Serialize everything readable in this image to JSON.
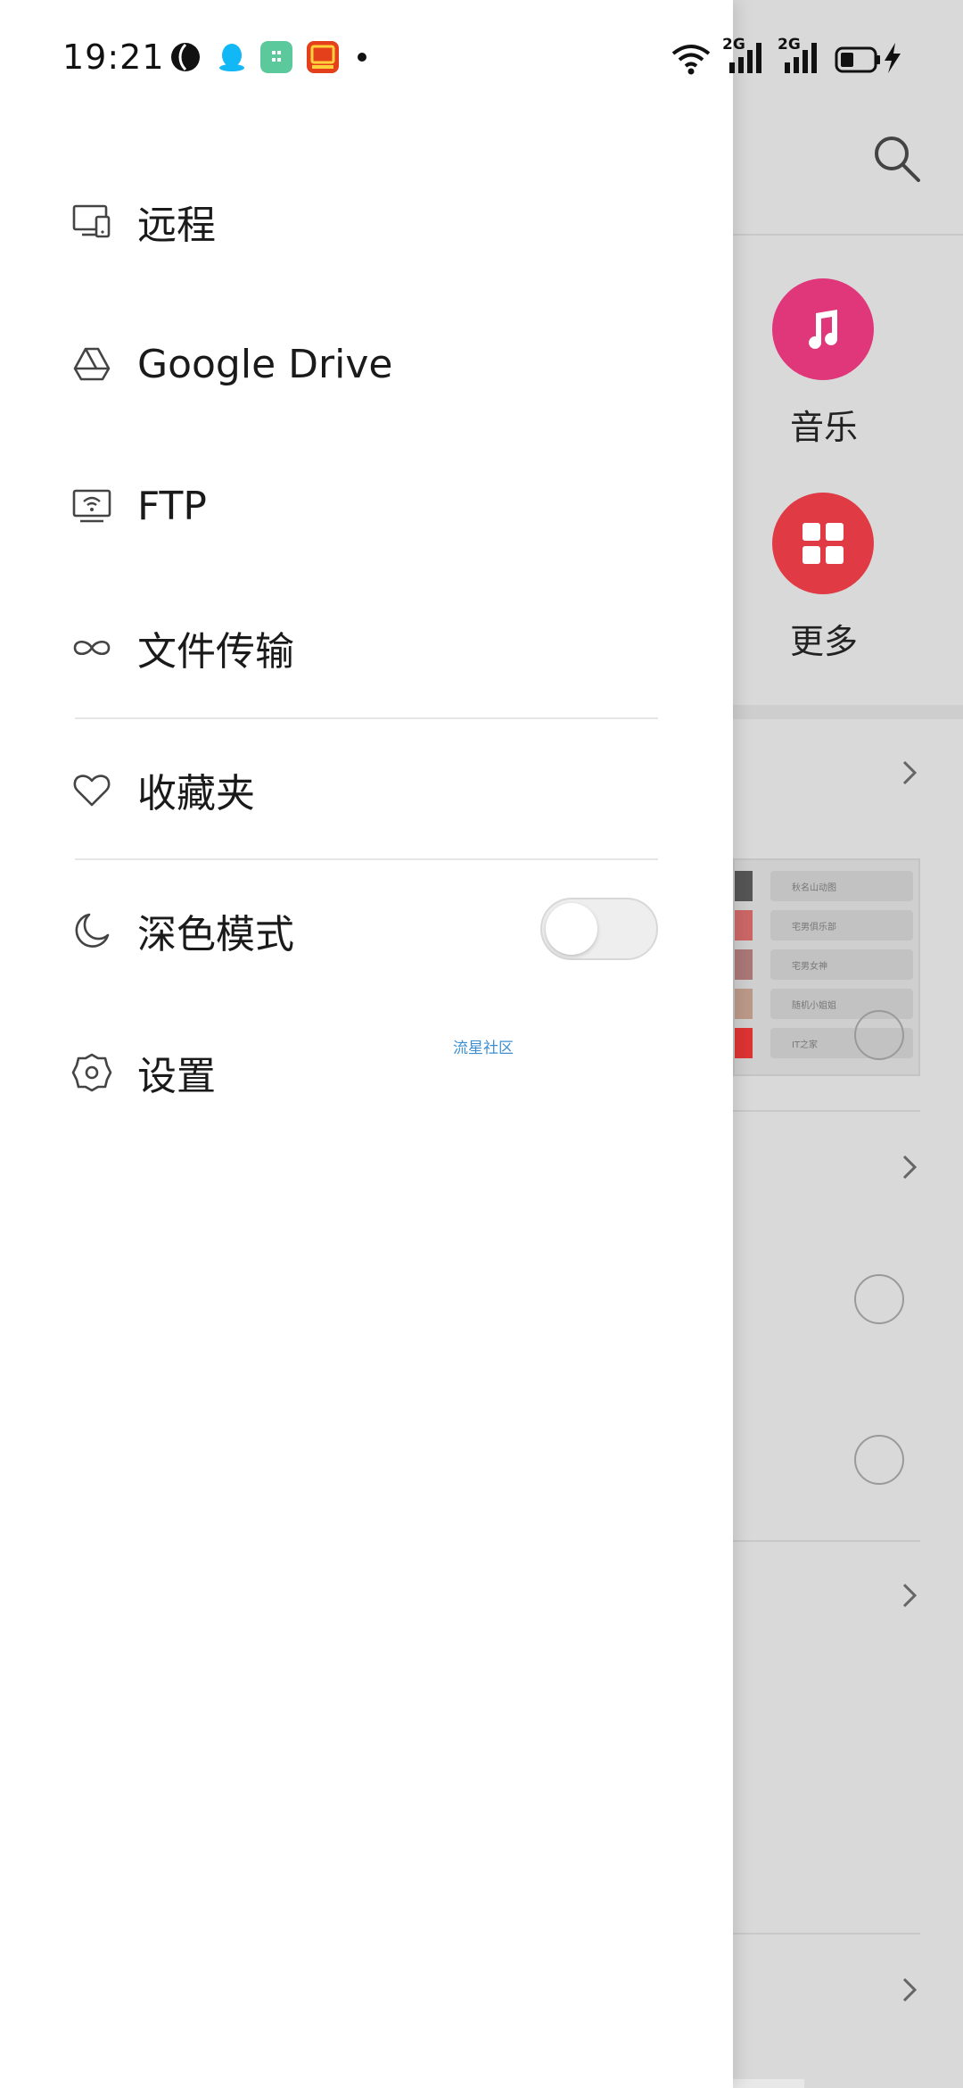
{
  "status_bar": {
    "time": "19:21",
    "notification_icons": [
      "app-a-icon",
      "qq-icon",
      "app-green-icon",
      "taobao-icon",
      "more-dot-icon"
    ],
    "network_labels": [
      "2G",
      "2G"
    ],
    "system_icons": [
      "wifi-icon",
      "signal-icon",
      "signal-icon",
      "battery-icon",
      "charging-icon"
    ]
  },
  "drawer": {
    "items": [
      {
        "label": "远程",
        "icon": "remote-device-icon"
      },
      {
        "label": "Google Drive",
        "icon": "google-drive-icon"
      },
      {
        "label": "FTP",
        "icon": "ftp-icon"
      },
      {
        "label": "文件传输",
        "icon": "file-transfer-icon"
      },
      {
        "label": "收藏夹",
        "icon": "heart-icon"
      },
      {
        "label": "深色模式",
        "icon": "moon-icon"
      },
      {
        "label": "设置",
        "icon": "gear-icon"
      }
    ],
    "dark_mode_enabled": false,
    "community_link": "流星社区"
  },
  "background_app": {
    "categories": [
      {
        "label": "音乐",
        "icon": "music-icon",
        "color": "#e0367a"
      },
      {
        "label": "更多",
        "icon": "grid-icon",
        "color": "#e03a44"
      }
    ],
    "list_preview": [
      "秋名山动图",
      "宅男俱乐部",
      "宅男女神",
      "随机小姐姐",
      "IT之家"
    ]
  },
  "colors": {
    "drawer_bg": "#ffffff",
    "overlay_bg": "#d9d9d9",
    "music_accent": "#e0367a",
    "more_accent": "#e03a44",
    "link": "#3d8fd1"
  }
}
